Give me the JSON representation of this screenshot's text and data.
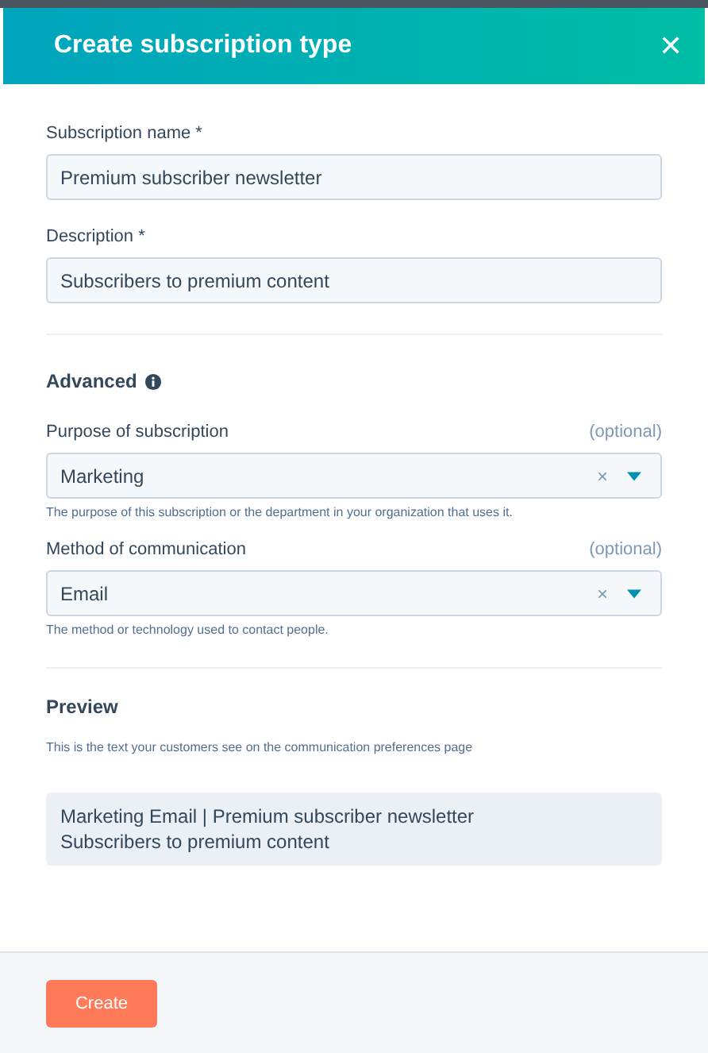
{
  "dialog": {
    "title": "Create subscription type",
    "close": "✕"
  },
  "fields": [
    {
      "label": "Subscription name *",
      "value": "Premium subscriber newsletter"
    },
    {
      "label": "Description *",
      "value": "Subscribers to premium content"
    }
  ],
  "advanced": {
    "title": "Advanced",
    "selects": [
      {
        "label": "Purpose of subscription",
        "optional": "(optional)",
        "value": "Marketing",
        "clear": "×",
        "help": "The purpose of this subscription or the department in your organization that uses it."
      },
      {
        "label": "Method of communication",
        "optional": "(optional)",
        "value": "Email",
        "clear": "×",
        "help": "The method or technology used to contact people."
      }
    ]
  },
  "preview": {
    "title": "Preview",
    "description": "This is the text your customers see on the communication preferences page",
    "lines": [
      "Marketing Email | Premium subscriber newsletter",
      "Subscribers to premium content"
    ]
  },
  "footer": {
    "button": "Create"
  }
}
